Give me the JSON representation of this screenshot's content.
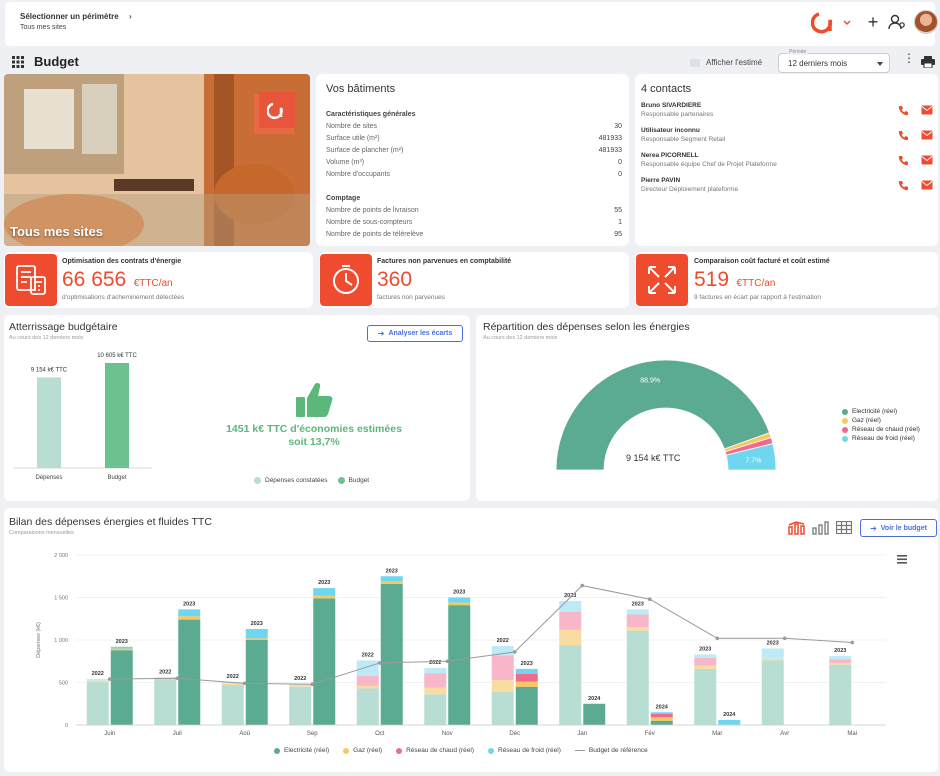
{
  "topbar": {
    "perimeter_label": "Sélectionner un périmètre",
    "perimeter_value": "Tous mes sites"
  },
  "toolbar": {
    "title": "Budget",
    "toggle_label": "Afficher l'estimé",
    "period_label": "Période",
    "period_value": "12 derniers mois"
  },
  "hero": {
    "caption": "Tous mes sites"
  },
  "buildings": {
    "title": "Vos bâtiments",
    "general_title": "Caractéristiques générales",
    "general": [
      {
        "label": "Nombre de sites",
        "value": "30"
      },
      {
        "label": "Surface utile (m²)",
        "value": "481933"
      },
      {
        "label": "Surface de plancher (m²)",
        "value": "481933"
      },
      {
        "label": "Volume (m³)",
        "value": "0"
      },
      {
        "label": "Nombre d'occupants",
        "value": "0"
      }
    ],
    "metering_title": "Comptage",
    "metering": [
      {
        "label": "Nombre de points de livraison",
        "value": "55"
      },
      {
        "label": "Nombre de sous-compteurs",
        "value": "1"
      },
      {
        "label": "Nombre de points de télérelève",
        "value": "95"
      }
    ]
  },
  "contacts": {
    "title": "4 contacts",
    "items": [
      {
        "name": "Bruno SIVARDIERE",
        "role": "Responsable partenaires"
      },
      {
        "name": "Utilisateur inconnu",
        "role": "Responsable Segment Retail"
      },
      {
        "name": "Nerea PICORNELL",
        "role": "Responsable équipe Chef de Projet Plateforme"
      },
      {
        "name": "Pierre PAVIN",
        "role": "Directeur Déploiement plateforme"
      }
    ]
  },
  "kpis": [
    {
      "title": "Optimisation des contrats d'énergie",
      "value": "66 656",
      "unit": "€TTC/an",
      "sub": "d'optimisations d'acheminement détectées"
    },
    {
      "title": "Factures non parvenues en comptabilité",
      "value": "360",
      "unit": "",
      "sub": "factures non parvenues"
    },
    {
      "title": "Comparaison coût facturé et coût estimé",
      "value": "519",
      "unit": "€TTC/an",
      "sub": "9 factures en écart par rapport à l'estimation"
    }
  ],
  "landing": {
    "title": "Atterrissage budgétaire",
    "subtitle": "Au cours des 12 derniers mois",
    "button": "Analyser les écarts",
    "savings_line1": "1451 k€ TTC d'économies estimées",
    "savings_line2": "soit 13,7%",
    "colors": {
      "spent": "#b8ddd3",
      "budget": "#6cc28e"
    },
    "legend": [
      "Dépenses constatées",
      "Budget"
    ]
  },
  "landing_chart": {
    "type": "bar",
    "categories": [
      "Dépenses",
      "Budget"
    ],
    "values": [
      9154,
      10605
    ],
    "value_labels": [
      "9 154 k€ TTC",
      "10 605 k€ TTC"
    ]
  },
  "distribution": {
    "title": "Répartition des dépenses selon les énergies",
    "subtitle": "Au cours des 12 derniers mois",
    "center_label": "9 154 k€ TTC"
  },
  "distribution_chart": {
    "type": "pie",
    "slices": [
      {
        "name": "Electricité (réel)",
        "value": 88.9,
        "label": "88.9%",
        "color": "#5bab92"
      },
      {
        "name": "Gaz (réel)",
        "value": 1.5,
        "label": "",
        "color": "#f7c760"
      },
      {
        "name": "Réseau de chaud (réel)",
        "value": 1.8,
        "label": "",
        "color": "#f06a8e"
      },
      {
        "name": "Réseau de froid (réel)",
        "value": 7.7,
        "label": "7.7%",
        "color": "#6fd6ef"
      }
    ]
  },
  "bilan": {
    "title": "Bilan des dépenses énergies et fluides TTC",
    "subtitle": "Comparaisons mensuelles",
    "button": "Voir le budget",
    "yaxis_label": "Dépenses (k€)"
  },
  "bilan_chart": {
    "type": "bar",
    "categories": [
      "Juin",
      "Juil",
      "Aoû",
      "Sep",
      "Oct",
      "Nov",
      "Déc",
      "Jan",
      "Fév",
      "Mar",
      "Avr",
      "Mai"
    ],
    "ylim": [
      0,
      2000
    ],
    "yticks": [
      "0",
      "500",
      "1 000",
      "1 500",
      "2 000"
    ],
    "left_year": [
      "2022",
      "2022",
      "2022",
      "2022",
      "2022",
      "2022",
      "2022",
      "2023",
      "2023",
      "2023",
      "2023",
      "2023"
    ],
    "right_year": [
      "2023",
      "2023",
      "2023",
      "2023",
      "2023",
      "2023",
      "2023",
      "2024",
      "2024",
      "2024",
      "",
      ""
    ],
    "series_left": [
      {
        "name": "Electricité (réel)",
        "values": [
          500,
          540,
          470,
          450,
          430,
          360,
          390,
          940,
          1110,
          660,
          760,
          710
        ]
      },
      {
        "name": "Gaz (réel)",
        "values": [
          20,
          20,
          15,
          15,
          30,
          80,
          140,
          180,
          40,
          40,
          20,
          20
        ]
      },
      {
        "name": "Réseau de chaud (réel)",
        "values": [
          0,
          0,
          0,
          0,
          120,
          170,
          290,
          210,
          150,
          90,
          0,
          40
        ]
      },
      {
        "name": "Réseau de froid (réel)",
        "values": [
          20,
          0,
          20,
          20,
          180,
          60,
          110,
          130,
          60,
          40,
          120,
          40
        ]
      }
    ],
    "series_right": [
      {
        "name": "Electricité (réel)",
        "values": [
          880,
          1240,
          1000,
          1490,
          1660,
          1410,
          450,
          250,
          50,
          0,
          0,
          0
        ]
      },
      {
        "name": "Gaz (réel)",
        "values": [
          20,
          40,
          20,
          30,
          30,
          30,
          60,
          0,
          40,
          0,
          0,
          0
        ]
      },
      {
        "name": "Réseau de chaud (réel)",
        "values": [
          0,
          0,
          0,
          0,
          0,
          0,
          90,
          0,
          40,
          0,
          0,
          0
        ]
      },
      {
        "name": "Réseau de froid (réel)",
        "values": [
          20,
          80,
          110,
          90,
          60,
          60,
          60,
          0,
          20,
          60,
          0,
          0
        ]
      }
    ],
    "reference_budget": [
      540,
      550,
      490,
      480,
      730,
      750,
      860,
      1640,
      1480,
      1020,
      1020,
      970
    ],
    "legend": [
      {
        "name": "Electricité (réel)",
        "color": "#5bab92"
      },
      {
        "name": "Gaz (réel)",
        "color": "#f7c760"
      },
      {
        "name": "Réseau de chaud (réel)",
        "color": "#f06a8e"
      },
      {
        "name": "Réseau de froid (réel)",
        "color": "#6fd6ef"
      },
      {
        "name": "Budget de référence",
        "color": "#999999"
      }
    ]
  }
}
